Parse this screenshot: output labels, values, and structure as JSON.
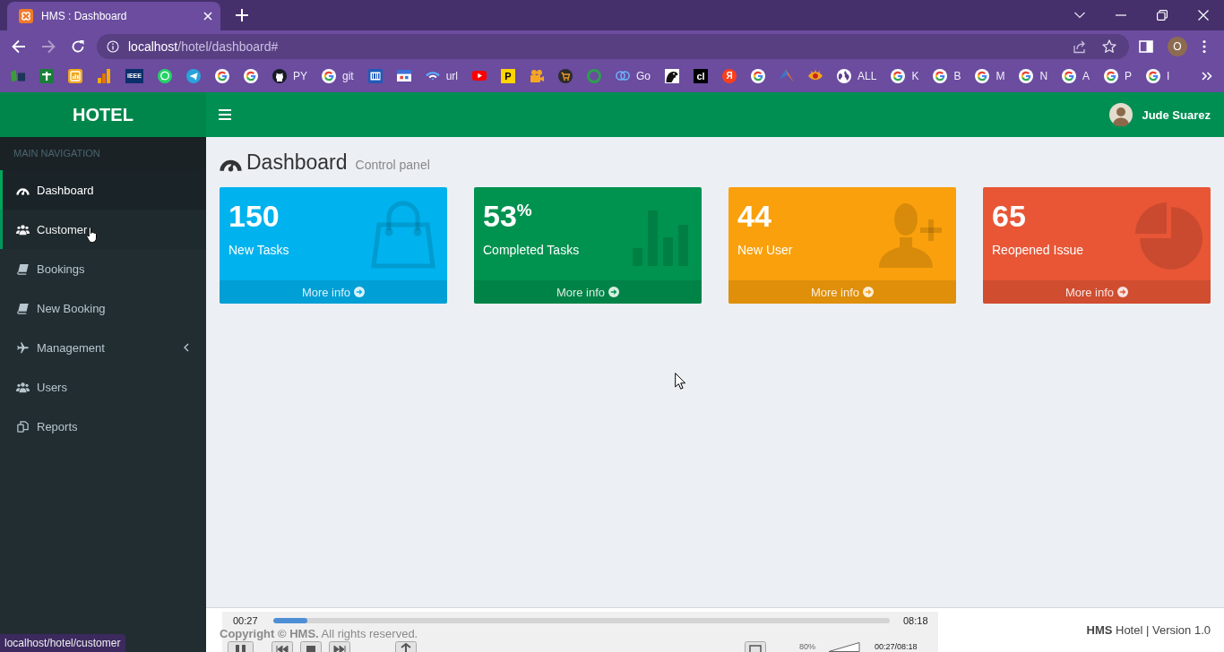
{
  "browser": {
    "tab": {
      "title": "HMS : Dashboard"
    },
    "url": "localhost/hotel/dashboard#",
    "forward": {
      "disabled": true
    },
    "profile": "O",
    "bookmarks": [
      {
        "kind": "blocks"
      },
      {
        "kind": "sheet"
      },
      {
        "kind": "chart-tile"
      },
      {
        "kind": "bars"
      },
      {
        "kind": "dark-tile",
        "glyph": "IEEE"
      },
      {
        "kind": "chat"
      },
      {
        "kind": "send"
      },
      {
        "kind": "g"
      },
      {
        "kind": "g"
      },
      {
        "kind": "github",
        "label": "PY"
      },
      {
        "kind": "g",
        "label": "git"
      },
      {
        "kind": "barcode"
      },
      {
        "kind": "calendar"
      },
      {
        "kind": "wifi",
        "label": "url"
      },
      {
        "kind": "play"
      },
      {
        "kind": "yellow-tile",
        "glyph": "P"
      },
      {
        "kind": "camera"
      },
      {
        "kind": "cart"
      },
      {
        "kind": "ring"
      },
      {
        "kind": "flower",
        "label": "Go"
      },
      {
        "kind": "bird"
      },
      {
        "kind": "black-tile",
        "glyph": "cl"
      },
      {
        "kind": "red-disc",
        "glyph": "Я"
      },
      {
        "kind": "g"
      },
      {
        "kind": "arrow"
      },
      {
        "kind": "eye"
      },
      {
        "kind": "globe",
        "label": "ALL"
      },
      {
        "kind": "g",
        "label": "K"
      },
      {
        "kind": "g",
        "label": "B"
      },
      {
        "kind": "g",
        "label": "M"
      },
      {
        "kind": "g",
        "label": "N"
      },
      {
        "kind": "g",
        "label": "A"
      },
      {
        "kind": "g",
        "label": "P"
      },
      {
        "kind": "g",
        "label": "I"
      }
    ],
    "status_url": "localhost/hotel/customer"
  },
  "app": {
    "logo": "HOTEL",
    "user": {
      "name": "Jude Suarez"
    }
  },
  "sidebar": {
    "header": "MAIN NAVIGATION",
    "items": [
      {
        "label": "Dashboard",
        "kind": "gauge",
        "selected": true,
        "hovered": false
      },
      {
        "label": "Customer",
        "kind": "users",
        "selected": false,
        "hovered": true
      },
      {
        "label": "Bookings",
        "kind": "book",
        "selected": false,
        "hovered": false
      },
      {
        "label": "New Booking",
        "kind": "book",
        "selected": false,
        "hovered": false
      },
      {
        "label": "Management",
        "kind": "plane",
        "selected": false,
        "hovered": false,
        "expanded": false
      },
      {
        "label": "Users",
        "kind": "users",
        "selected": false,
        "hovered": false
      },
      {
        "label": "Reports",
        "kind": "copy",
        "selected": false,
        "hovered": false
      }
    ]
  },
  "content": {
    "title": "Dashboard",
    "subtitle": "Control panel",
    "cards": [
      {
        "value": "150",
        "label": "New Tasks",
        "link": "More info",
        "color": "#00b2ee",
        "kind": "bag"
      },
      {
        "value": "53$^{%}$",
        "label": "Completed Tasks",
        "link": "More info",
        "color": "#00924f",
        "kind": "bars"
      },
      {
        "value": "44",
        "label": "New User",
        "link": "More info",
        "color": "#f9a00c",
        "kind": "user-plus"
      },
      {
        "value": "65",
        "label": "Reopened Issue",
        "link": "More info",
        "color": "#e85636",
        "kind": "pie"
      }
    ]
  },
  "footer": {
    "copyright": "**Copyright © HMS.** All rights reserved.",
    "version": "**HMS** Hotel | Version 1.0"
  },
  "player": {
    "elapsed": "00:27",
    "duration": "08:18",
    "level": 0.055,
    "volume": "80%",
    "time": "00:27/08:18"
  }
}
